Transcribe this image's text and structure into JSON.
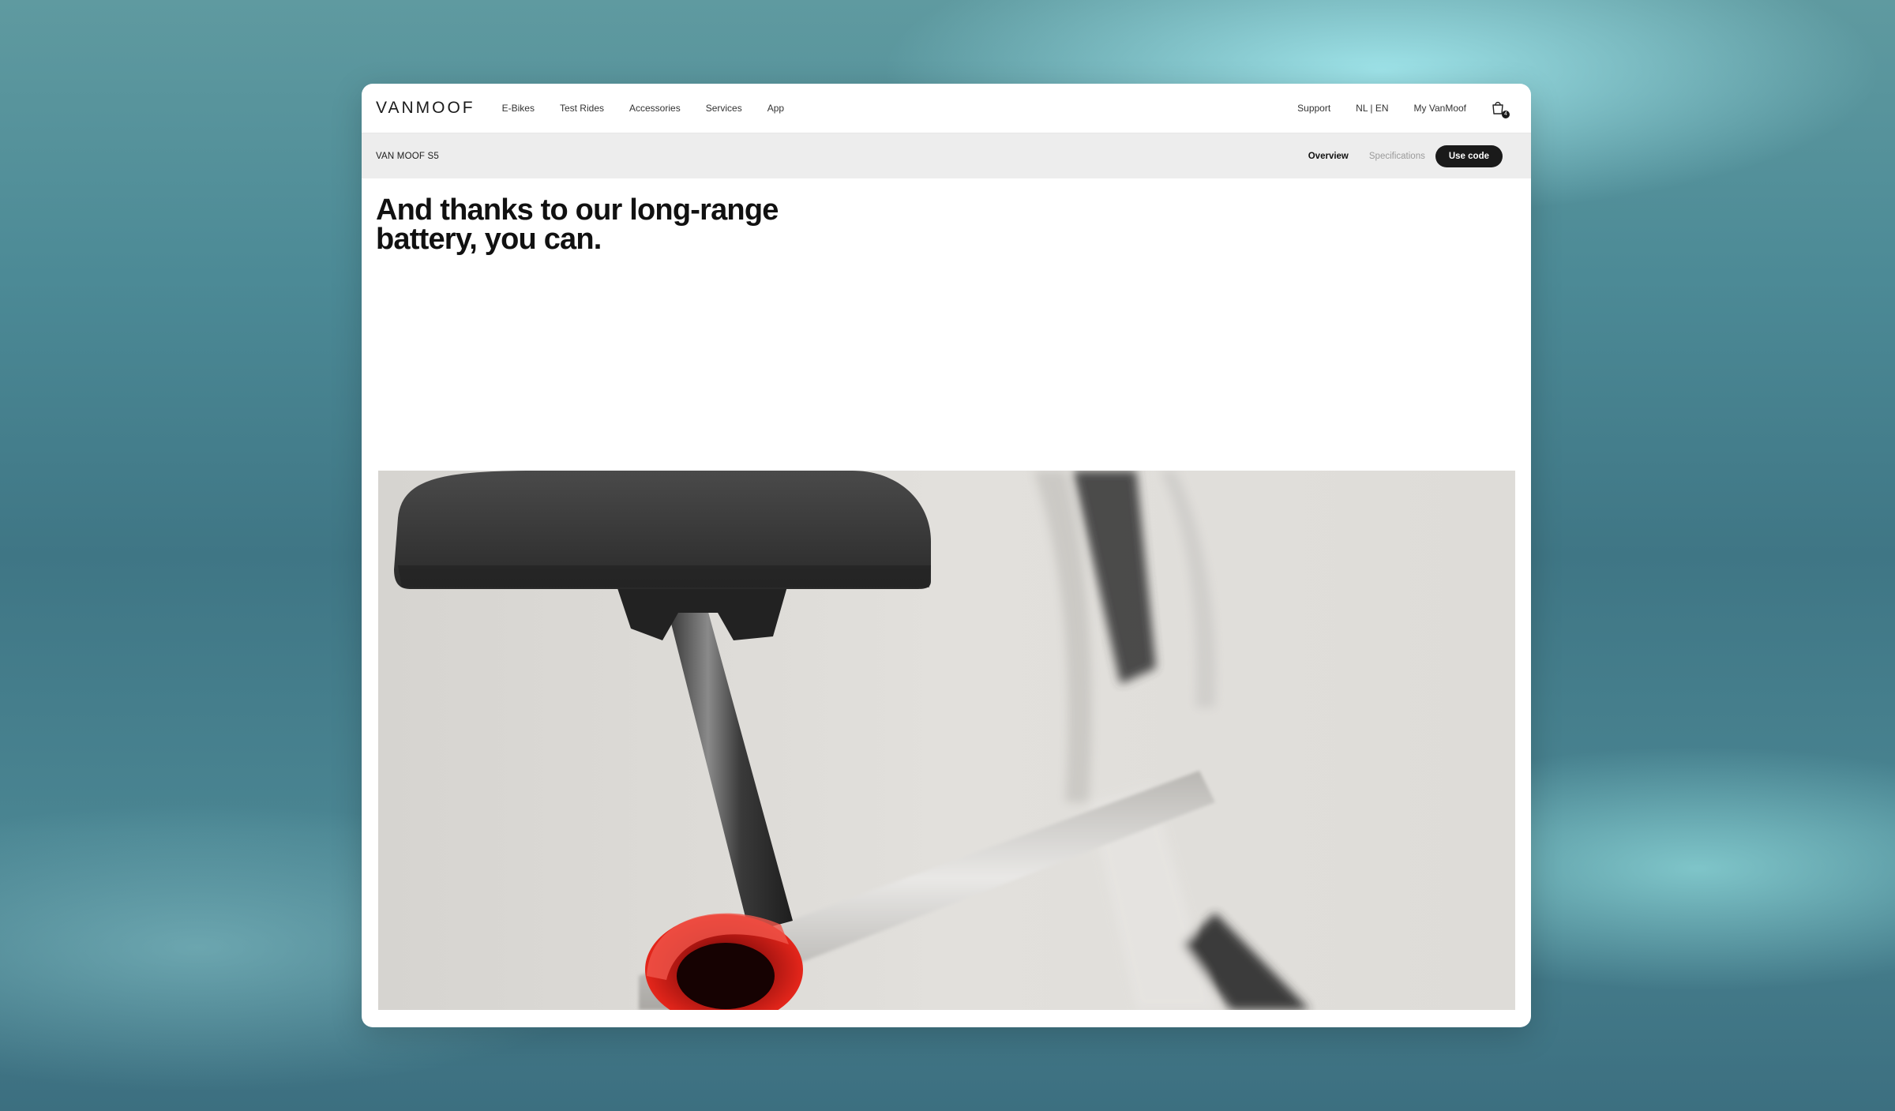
{
  "header": {
    "logo": "VANMOOF",
    "nav": [
      "E-Bikes",
      "Test Rides",
      "Accessories",
      "Services",
      "App"
    ],
    "right": [
      "Support",
      "NL | EN",
      "My VanMoof"
    ],
    "cart_icon": "bag-icon",
    "cart_count": "4"
  },
  "subnav": {
    "product": "VAN MOOF S5",
    "tabs": [
      "Overview",
      "Specifications"
    ],
    "active_tab": "Overview",
    "cta": "Use code"
  },
  "hero": {
    "headline": "And thanks to our long-range battery, you can.",
    "image": "bike-saddle-seatpost-closeup"
  },
  "colors": {
    "cta_bg": "#1a1a1a",
    "subnav_bg": "#ededed",
    "light_accent": "#e5261b"
  }
}
